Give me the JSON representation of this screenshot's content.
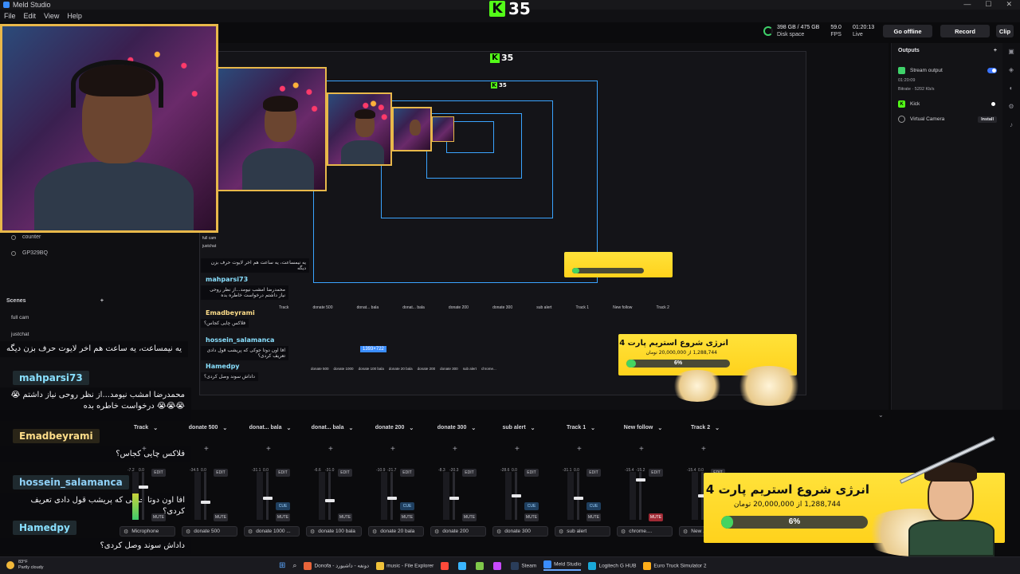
{
  "window": {
    "title": "Meld Studio",
    "controls": [
      "—",
      "☐",
      "✕"
    ]
  },
  "menu": [
    "File",
    "Edit",
    "View",
    "Help"
  ],
  "kick": {
    "logo": "K",
    "viewers": "35"
  },
  "stats": {
    "disk": {
      "value": "398 GB / 475 GB",
      "label": "Disk space"
    },
    "fps": {
      "value": "59.0",
      "label": "FPS"
    },
    "live": {
      "value": "01:20:13",
      "label": "Live"
    }
  },
  "buttons": {
    "go_offline": "Go offline",
    "record": "Record",
    "clip": "Clip"
  },
  "sources": [
    "counter",
    "GP329BQ"
  ],
  "scenes": {
    "title": "Scenes",
    "add": "+",
    "items": [
      "full cam",
      "justchat"
    ]
  },
  "chat": [
    {
      "user": "",
      "text": "یه نیمساعت، یه ساعت هم اخر لایوت حرف بزن دیگه"
    },
    {
      "user": "mahparsi73",
      "text": "محمدرضا امشب نیومد...از نظر روحی نیاز داشتم 😭😭😭😭 درخواست خاطره بده"
    },
    {
      "user": "Emadbeyrami",
      "text": "فلاکس چایی کجاس؟"
    },
    {
      "user": "hossein_salamanca",
      "text": "افا اون دوتا جوکی که پریشب قول دادی تعریف کردی؟"
    },
    {
      "user": "Hamedpy",
      "text": "داداش سوند وصل کردی؟"
    }
  ],
  "mixer": {
    "channels": [
      {
        "title": "Track",
        "db_left": "-7.2",
        "db_right": "0.0",
        "level": 0.55,
        "fader": 0.7,
        "source": "Microphone",
        "muted": false,
        "cue": false
      },
      {
        "title": "donate 500",
        "db_left": "-34.5",
        "db_right": "0.0",
        "level": 0.0,
        "fader": 0.35,
        "source": "donate 500",
        "muted": false,
        "cue": false
      },
      {
        "title": "donat... bala",
        "db_left": "-31.1",
        "db_right": "0.0",
        "level": 0.0,
        "fader": 0.45,
        "source": "donate 1000 ...",
        "muted": false,
        "cue": true
      },
      {
        "title": "donat... bala",
        "db_left": "-6.6",
        "db_right": "-31.0",
        "level": 0.0,
        "fader": 0.4,
        "source": "donate 100 bala",
        "muted": false,
        "cue": false
      },
      {
        "title": "donate 200",
        "db_left": "-10.9",
        "db_right": "-21.7",
        "level": 0.0,
        "fader": 0.45,
        "source": "donate 20 bala",
        "muted": false,
        "cue": true
      },
      {
        "title": "donate 300",
        "db_left": "-8.3",
        "db_right": "-20.3",
        "level": 0.0,
        "fader": 0.45,
        "source": "donate 200",
        "muted": false,
        "cue": false
      },
      {
        "title": "sub alert",
        "db_left": "-28.6",
        "db_right": "0.0",
        "level": 0.0,
        "fader": 0.5,
        "source": "donate 300",
        "muted": false,
        "cue": true
      },
      {
        "title": "Track 1",
        "db_left": "-31.1",
        "db_right": "0.0",
        "level": 0.0,
        "fader": 0.45,
        "source": "sub alert",
        "muted": false,
        "cue": true
      },
      {
        "title": "New follow",
        "db_left": "-15.4",
        "db_right": "-15.2",
        "level": 0.0,
        "fader": 0.85,
        "source": "chrome....",
        "muted": true,
        "cue": false
      },
      {
        "title": "Track 2",
        "db_left": "-15.4",
        "db_right": "0.0",
        "level": 0.0,
        "fader": 0.5,
        "source": "New ...",
        "muted": false,
        "cue": false
      }
    ],
    "labels": {
      "edit": "EDIT",
      "cue": "CUE",
      "mute": "MUTE",
      "add": "+"
    }
  },
  "outputs": {
    "title": "Outputs",
    "add": "+",
    "stream": {
      "label": "Stream output",
      "time": "01:20:09",
      "bitrate": "Bitrate · 5202 Kb/s",
      "enabled": true
    },
    "kick": {
      "label": "Kick",
      "live": true
    },
    "virtual_camera": {
      "label": "Virtual Camera",
      "install": "Install"
    }
  },
  "alert": {
    "title": "انرژی شروع استریم پارت 4",
    "subtitle": "1,288,744 از 20,000,000 تومان",
    "percent": "6%",
    "progress": 0.06,
    "color": "#ffd21c",
    "bar_color": "#45d460"
  },
  "preview_nested": {
    "chat_names": [
      "mahparsi73",
      "Emadbeyrami",
      "hossein_salamanca",
      "Hamedpy"
    ],
    "chat_texts": [
      "یه نیمساعت، یه ساعت هم اخر لایوت حرف بزن دیگه",
      "محمدرضا امشب نیومد...از نظر روحی نیاز داشتم درخواست خاطره بده",
      "فلاکس چایی کجاس؟",
      "افا اون دوتا جوکی که پریشب قول دادی تعریف کردی؟",
      "داداش سوند وصل کردی؟"
    ],
    "resolution_tag": "1393×722",
    "mixer_titles": [
      "Track",
      "donate 500",
      "donat... bala",
      "donat... bala",
      "donate 200",
      "donate 300",
      "sub alert",
      "Track 1",
      "New follow",
      "Track 2"
    ],
    "source_names": [
      "donate 500",
      "donate 1000",
      "donate 100 bala",
      "donate 20 bala",
      "donate 200",
      "donate 300",
      "sub alert",
      "chrome..."
    ],
    "scene_labels": [
      "full cam",
      "justchat"
    ]
  },
  "taskbar": {
    "weather": {
      "temp": "83°F",
      "desc": "Partly cloudy"
    },
    "apps": [
      {
        "label": "Donofa - دونفه - داشبورد",
        "color": "#e8643a"
      },
      {
        "label": "music - File Explorer",
        "color": "#f0c23a"
      },
      {
        "label": "",
        "color": "#ff4a3a"
      },
      {
        "label": "",
        "color": "#3ab5ff"
      },
      {
        "label": "",
        "color": "#7fc84a"
      },
      {
        "label": "",
        "color": "#c84aff"
      },
      {
        "label": "Steam",
        "color": "#2a3d5a"
      },
      {
        "label": "Meld Studio",
        "color": "#3a8dff"
      },
      {
        "label": "Logitech G HUB",
        "color": "#1aa8d8"
      },
      {
        "label": "Euro Truck Simulator 2",
        "color": "#ffae1a"
      }
    ]
  }
}
